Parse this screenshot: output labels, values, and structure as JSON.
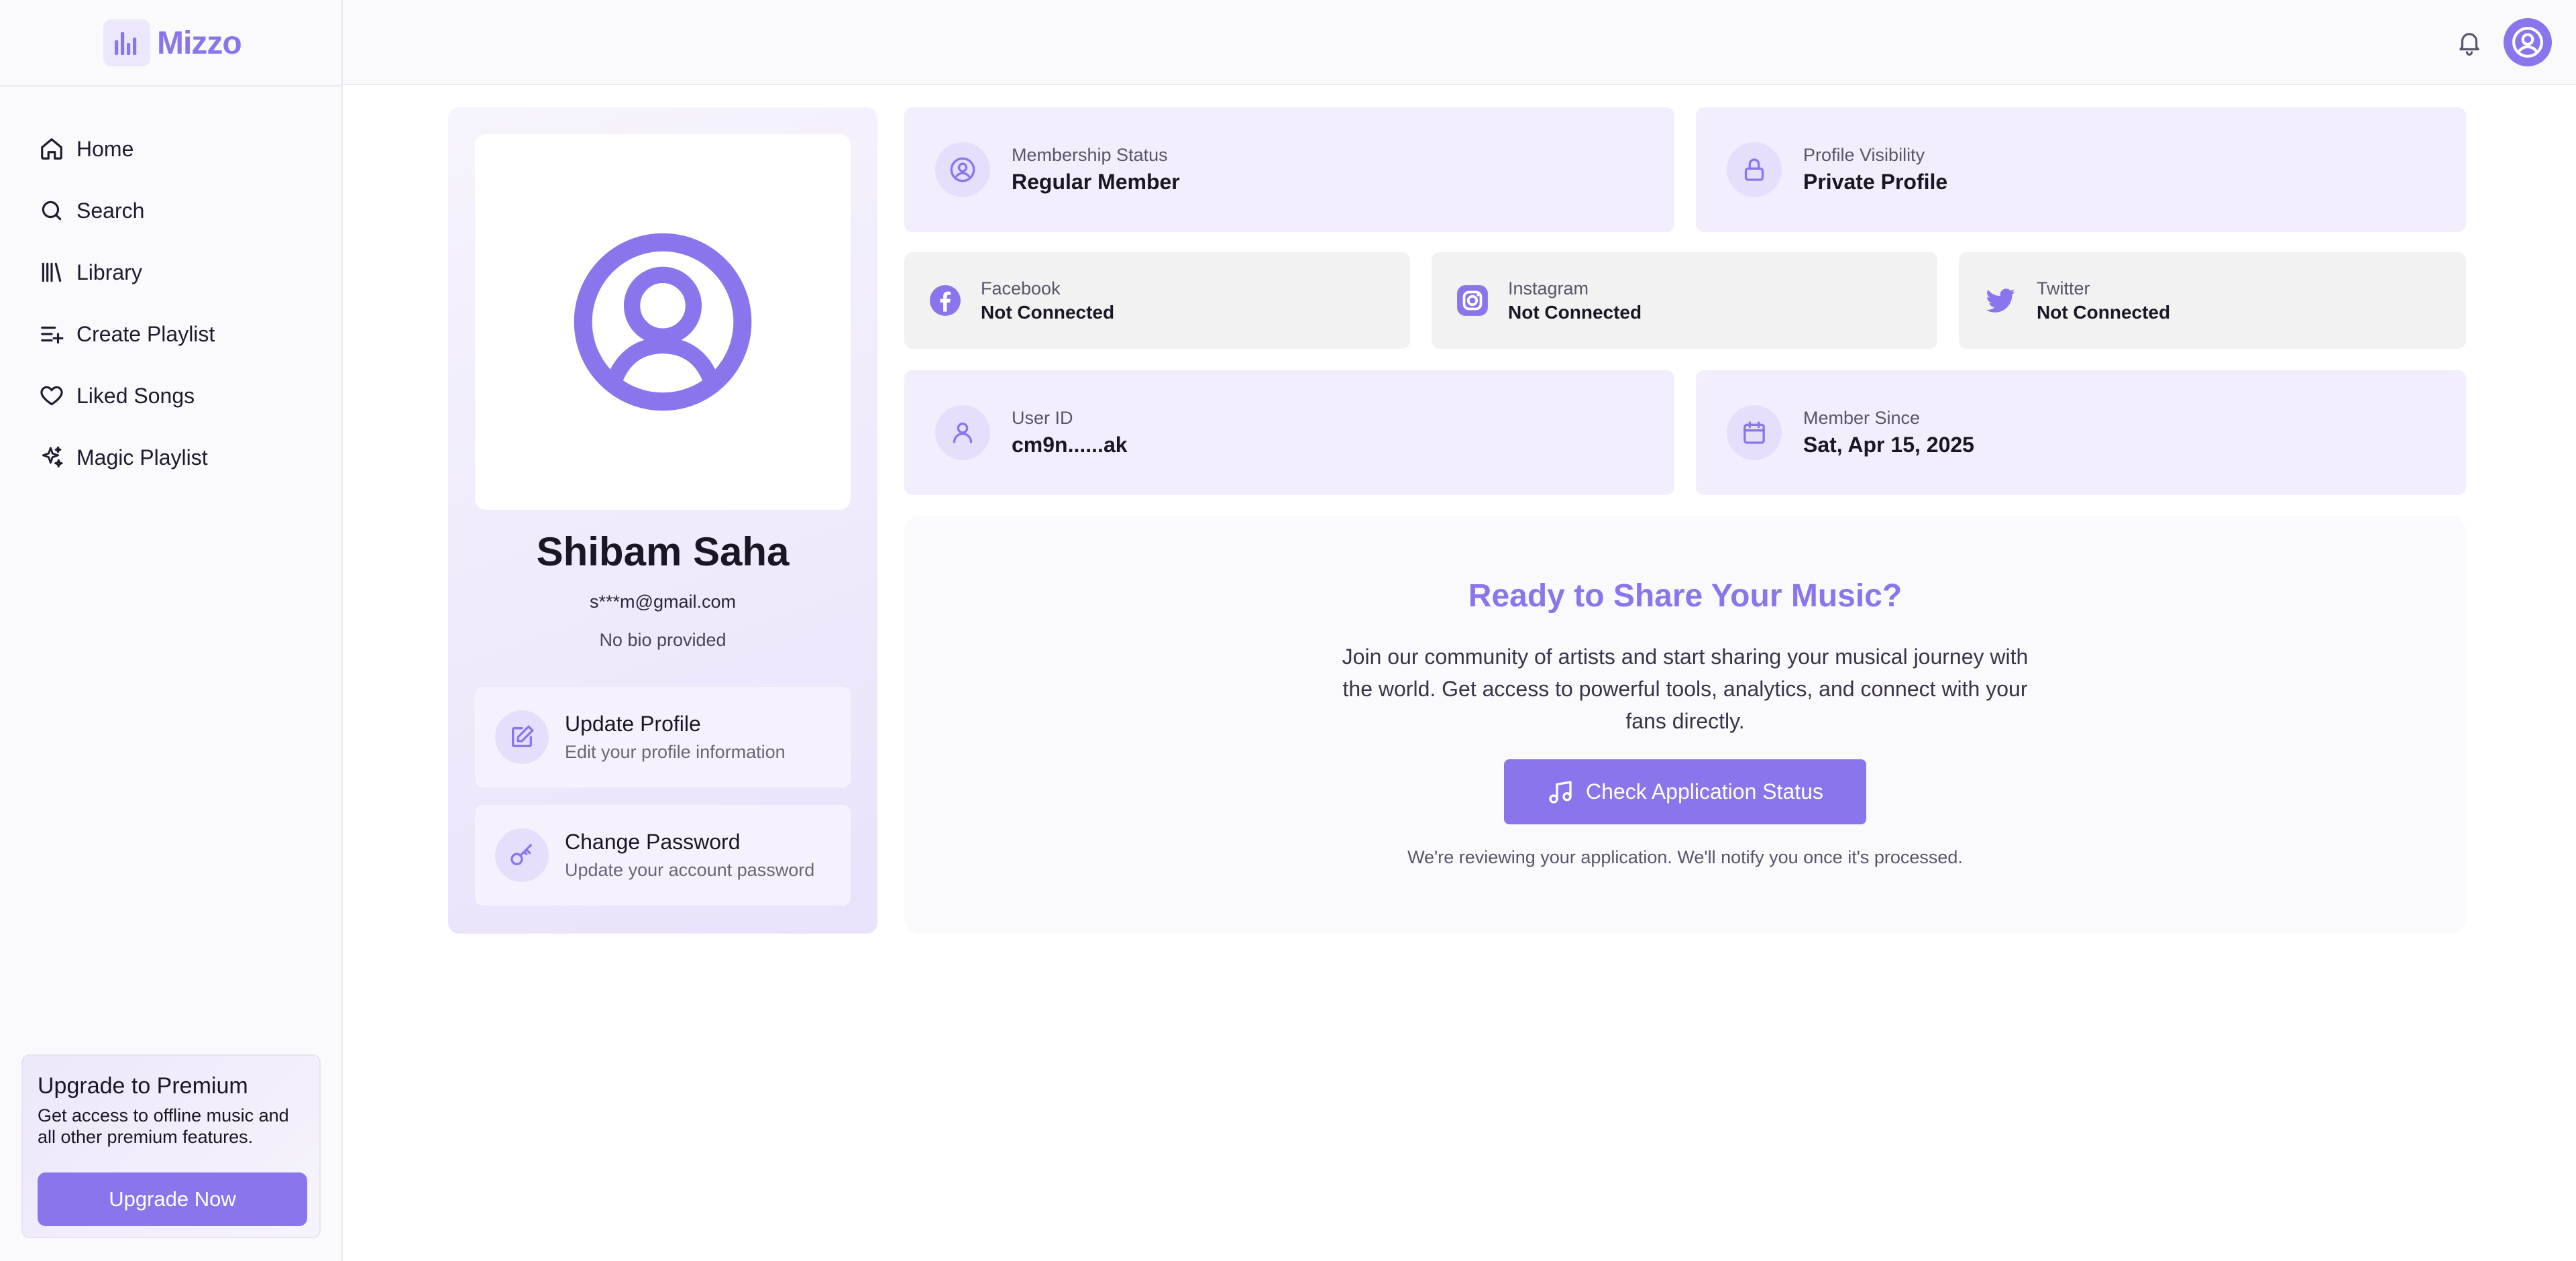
{
  "app": {
    "name": "Mizzo",
    "accent": "#8b75ec"
  },
  "sidebar": {
    "items": [
      {
        "label": "Home",
        "icon": "home-icon"
      },
      {
        "label": "Search",
        "icon": "search-icon"
      },
      {
        "label": "Library",
        "icon": "library-icon"
      },
      {
        "label": "Create Playlist",
        "icon": "create-playlist-icon"
      },
      {
        "label": "Liked Songs",
        "icon": "heart-icon"
      },
      {
        "label": "Magic Playlist",
        "icon": "sparkles-icon"
      }
    ],
    "promo": {
      "title": "Upgrade to Premium",
      "description": "Get access to offline music and all other premium features.",
      "button": "Upgrade Now"
    }
  },
  "profile": {
    "name": "Shibam Saha",
    "email": "s***m@gmail.com",
    "bio": "No bio provided",
    "actions": [
      {
        "title": "Update Profile",
        "subtitle": "Edit your profile information",
        "icon": "edit-icon"
      },
      {
        "title": "Change Password",
        "subtitle": "Update your account password",
        "icon": "key-icon"
      }
    ]
  },
  "info": {
    "membership": {
      "label": "Membership Status",
      "value": "Regular Member"
    },
    "visibility": {
      "label": "Profile Visibility",
      "value": "Private Profile"
    },
    "user_id": {
      "label": "User ID",
      "value": "cm9n......ak"
    },
    "member_since": {
      "label": "Member Since",
      "value": "Sat, Apr 15, 2025"
    }
  },
  "social": [
    {
      "label": "Facebook",
      "value": "Not Connected",
      "icon": "facebook-icon"
    },
    {
      "label": "Instagram",
      "value": "Not Connected",
      "icon": "instagram-icon"
    },
    {
      "label": "Twitter",
      "value": "Not Connected",
      "icon": "twitter-icon"
    }
  ],
  "share": {
    "title": "Ready to Share Your Music?",
    "description": "Join our community of artists and start sharing your musical journey with the world. Get access to powerful tools, analytics, and connect with your fans directly.",
    "button": "Check Application Status",
    "note": "We're reviewing your application. We'll notify you once it's processed."
  }
}
